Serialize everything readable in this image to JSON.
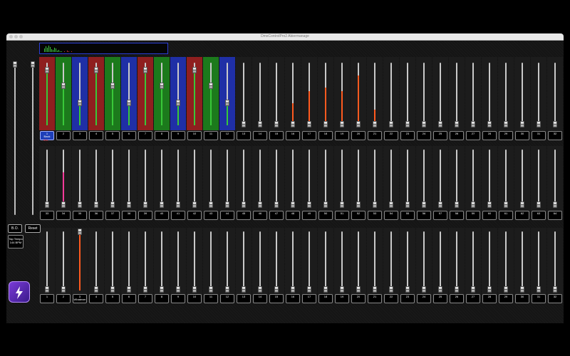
{
  "window": {
    "title": "DmxControlPro2 Abiermanage"
  },
  "side": {
    "bo_label": "B.O.",
    "reset_label": "Reset",
    "tap_label": "Tap Tempo",
    "bpm_label": "144 BPM"
  },
  "colors": {
    "red": "#8f1f1f",
    "green": "#1c7a1c",
    "blue": "#1f2fa6",
    "accent_purple": "#6b35c9",
    "orange": "#ff5a1f",
    "pink": "#ff3a9a"
  },
  "status_label_1": "Mst",
  "row1": {
    "labels": [
      "1",
      "2",
      "3",
      "4",
      "5",
      "6",
      "7",
      "8",
      "9",
      "10",
      "11",
      "12",
      "13",
      "14",
      "15",
      "16",
      "17",
      "18",
      "19",
      "20",
      "21",
      "22",
      "23",
      "24",
      "25",
      "26",
      "27",
      "28",
      "29",
      "30",
      "31",
      "32"
    ],
    "sublabel_1": "Back",
    "color_cells": [
      "red",
      "green",
      "blue",
      "red",
      "green",
      "blue",
      "red",
      "green",
      "blue",
      "red",
      "green",
      "blue"
    ],
    "levels": [
      0.88,
      0.62,
      0.35,
      0.88,
      0.62,
      0.35,
      0.88,
      0.62,
      0.35,
      0.88,
      0.62,
      0.35,
      0.01,
      0.01,
      0.01,
      0.01,
      0.01,
      0.01,
      0.01,
      0.01,
      0.01,
      0.01,
      0.01,
      0.01,
      0.01,
      0.01,
      0.01,
      0.01,
      0.01,
      0.01,
      0.01,
      0.01
    ],
    "orange_peaks": {
      "16": 0.35,
      "17": 0.55,
      "18": 0.6,
      "19": 0.55,
      "20": 0.8,
      "21": 0.25
    }
  },
  "row2": {
    "labels": [
      "33",
      "34",
      "35",
      "36",
      "37",
      "38",
      "39",
      "40",
      "41",
      "42",
      "43",
      "44",
      "45",
      "46",
      "47",
      "48",
      "49",
      "50",
      "51",
      "52",
      "53",
      "54",
      "55",
      "56",
      "57",
      "58",
      "59",
      "60",
      "61",
      "62",
      "63",
      "64"
    ],
    "levels": [
      0.01,
      0.01,
      0.01,
      0.01,
      0.01,
      0.01,
      0.01,
      0.01,
      0.01,
      0.01,
      0.01,
      0.01,
      0.01,
      0.01,
      0.01,
      0.01,
      0.01,
      0.01,
      0.01,
      0.01,
      0.01,
      0.01,
      0.01,
      0.01,
      0.01,
      0.01,
      0.01,
      0.01,
      0.01,
      0.01,
      0.01,
      0.01
    ],
    "pink_peak_index": 1,
    "pink_peak": 0.6
  },
  "row3": {
    "labels": [
      "1",
      "2",
      "3",
      "4",
      "5",
      "6",
      "7",
      "8",
      "9",
      "10",
      "11",
      "12",
      "13",
      "14",
      "15",
      "16",
      "17",
      "18",
      "19",
      "20",
      "21",
      "22",
      "23",
      "24",
      "25",
      "26",
      "27",
      "28",
      "29",
      "30",
      "31",
      "32"
    ],
    "sublabel_3": "Whatever",
    "levels": [
      0.01,
      0.01,
      1.0,
      0.01,
      0.01,
      0.01,
      0.01,
      0.01,
      0.01,
      0.01,
      0.01,
      0.01,
      0.01,
      0.01,
      0.01,
      0.01,
      0.01,
      0.01,
      0.01,
      0.01,
      0.01,
      0.01,
      0.01,
      0.01,
      0.01,
      0.01,
      0.01,
      0.01,
      0.01,
      0.01,
      0.01,
      0.01
    ]
  },
  "master": {
    "left_level": 0.98,
    "right_level": 0.98
  }
}
